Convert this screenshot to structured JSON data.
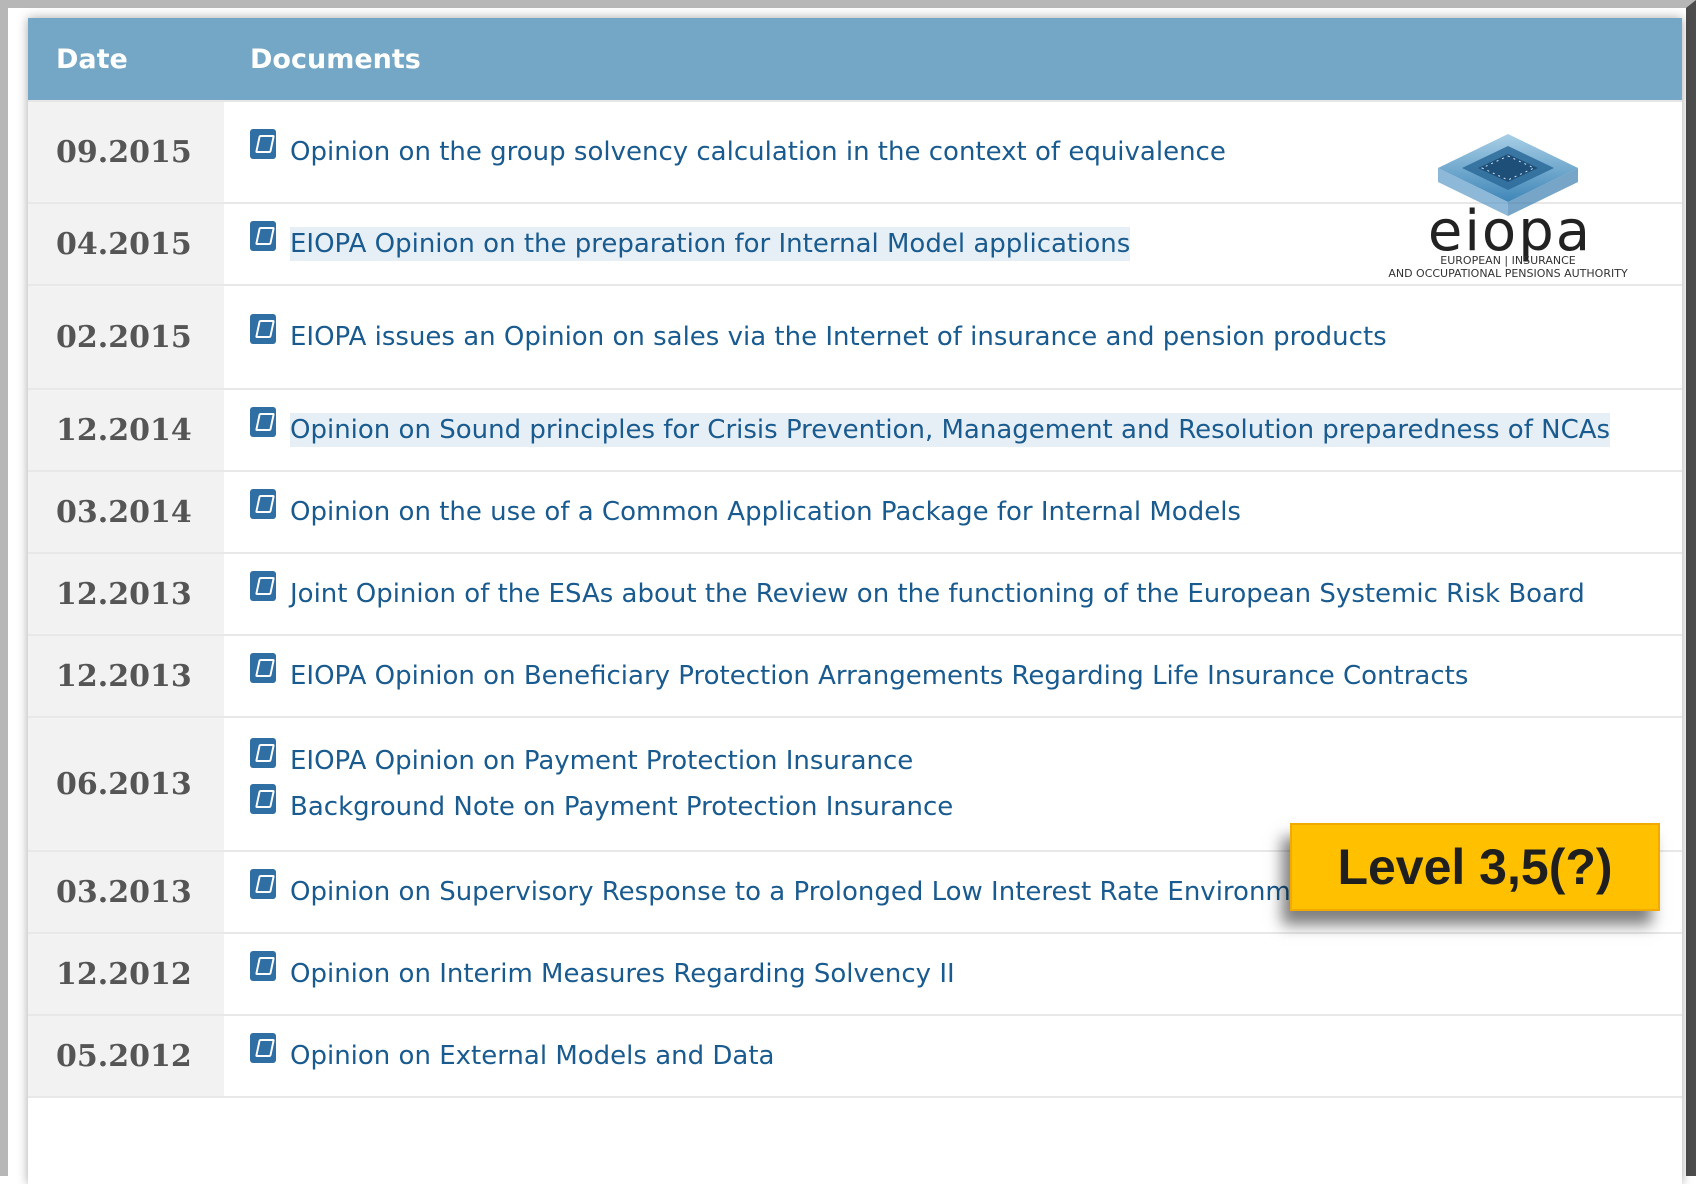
{
  "table": {
    "headers": {
      "date": "Date",
      "documents": "Documents"
    },
    "rows": [
      {
        "date": "09.2015",
        "docs": [
          {
            "title": "Opinion on the group solvency calculation in the context of equivalence",
            "highlight": false
          }
        ]
      },
      {
        "date": "04.2015",
        "docs": [
          {
            "title": "EIOPA Opinion on the preparation for Internal Model applications",
            "highlight": true
          }
        ]
      },
      {
        "date": "02.2015",
        "docs": [
          {
            "title": "EIOPA issues an Opinion on sales via the Internet of insurance and pension products",
            "highlight": false
          }
        ]
      },
      {
        "date": "12.2014",
        "docs": [
          {
            "title": "Opinion on Sound principles for Crisis Prevention, Management and Resolution preparedness of NCAs",
            "highlight": true
          }
        ]
      },
      {
        "date": "03.2014",
        "docs": [
          {
            "title": "Opinion on the use of a Common Application Package for Internal Models",
            "highlight": false
          }
        ]
      },
      {
        "date": "12.2013",
        "docs": [
          {
            "title": "Joint Opinion of the ESAs about the Review on the functioning of the European Systemic Risk Board",
            "highlight": false
          }
        ]
      },
      {
        "date": "12.2013",
        "docs": [
          {
            "title": "EIOPA Opinion on Beneficiary Protection Arrangements Regarding Life Insurance Contracts",
            "highlight": false
          }
        ]
      },
      {
        "date": "06.2013",
        "docs": [
          {
            "title": "EIOPA Opinion on Payment Protection Insurance",
            "highlight": false
          },
          {
            "title": "Background Note on Payment Protection Insurance",
            "highlight": false
          }
        ]
      },
      {
        "date": "03.2013",
        "docs": [
          {
            "title": "Opinion on Supervisory Response to a Prolonged Low Interest Rate Environment",
            "highlight": false
          }
        ]
      },
      {
        "date": "12.2012",
        "docs": [
          {
            "title": "Opinion on Interim Measures Regarding Solvency II",
            "highlight": false
          }
        ]
      },
      {
        "date": "05.2012",
        "docs": [
          {
            "title": "Opinion on External Models and Data",
            "highlight": false
          }
        ]
      }
    ]
  },
  "logo": {
    "wordmark": "eiopa",
    "line1": "EUROPEAN | INSURANCE",
    "line2": "AND OCCUPATIONAL PENSIONS AUTHORITY"
  },
  "badge": {
    "label": "Level 3,5(?)"
  },
  "icons": {
    "document_icon": "pdf-icon"
  },
  "colors": {
    "header_bg": "#74a6c5",
    "link": "#1a5b8f",
    "badge_bg": "#ffc000",
    "date_col_bg": "#f2f2f2"
  }
}
